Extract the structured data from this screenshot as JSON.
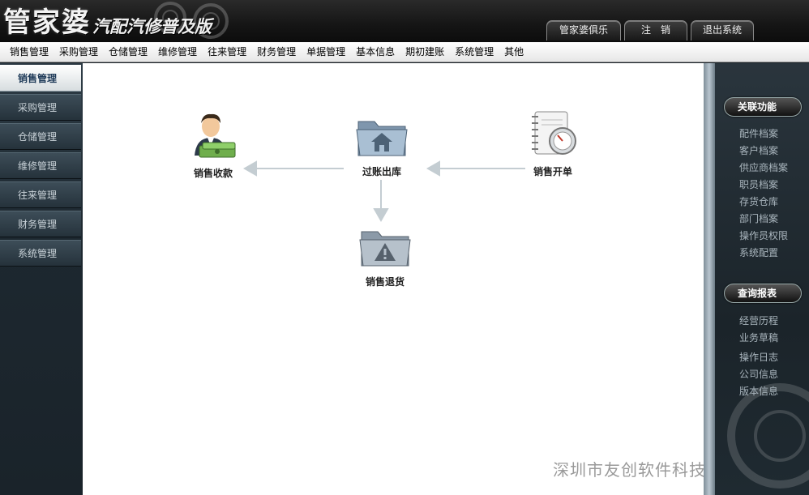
{
  "app": {
    "logo_main": "管家婆",
    "logo_sub": "汽配汽修普及版"
  },
  "top_buttons": [
    "管家婆俱乐部",
    "注　销",
    "退出系统"
  ],
  "menu": [
    "销售管理",
    "采购管理",
    "仓储管理",
    "维修管理",
    "往来管理",
    "财务管理",
    "单据管理",
    "基本信息",
    "期初建账",
    "系统管理",
    "其他"
  ],
  "sidebar": {
    "items": [
      "销售管理",
      "采购管理",
      "仓储管理",
      "维修管理",
      "往来管理",
      "财务管理",
      "系统管理"
    ],
    "active": "销售管理"
  },
  "flow": {
    "sales_receipt": "销售收款",
    "posting_outbound": "过账出库",
    "sales_order": "销售开单",
    "sales_return": "销售退货"
  },
  "watermark": "深圳市友创软件科技有限公司",
  "right_panel": {
    "related_title": "关联功能",
    "related_links": [
      "配件档案",
      "客户档案",
      "供应商档案",
      "职员档案",
      "存货仓库",
      "部门档案",
      "操作员权限",
      "系统配置"
    ],
    "report_title": "查询报表",
    "report_links": [
      "经营历程",
      "业务草稿",
      "操作日志",
      "公司信息",
      "版本信息"
    ]
  },
  "colors": {
    "header_bg": "#151515",
    "sidebar_bg": "#1d2830",
    "content_bg": "#ffffff",
    "arrow": "#c4cdd2"
  }
}
